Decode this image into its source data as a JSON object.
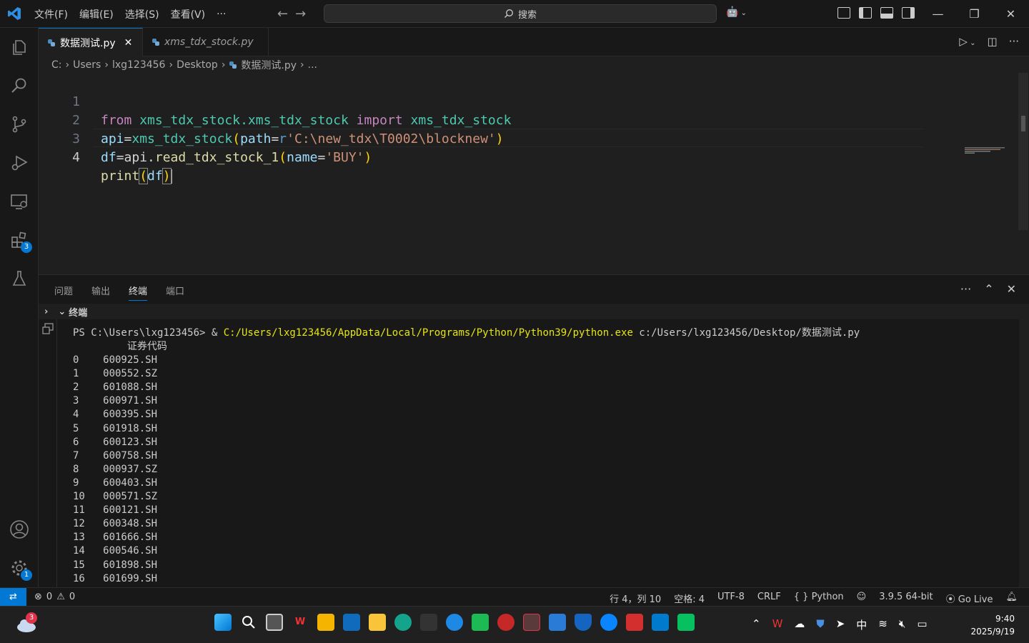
{
  "titlebar": {
    "menu": [
      "文件(F)",
      "编辑(E)",
      "选择(S)",
      "查看(V)",
      "···"
    ],
    "search_placeholder": "搜索"
  },
  "tabs": [
    {
      "label": "数据测试.py",
      "active": true
    },
    {
      "label": "xms_tdx_stock.py",
      "active": false
    }
  ],
  "breadcrumb": [
    "C:",
    "Users",
    "lxg123456",
    "Desktop",
    "数据测试.py",
    "..."
  ],
  "editor": {
    "line_numbers": [
      "1",
      "2",
      "3",
      "4"
    ],
    "lines": [
      {
        "kw": "from",
        "mod1": "xms_tdx_stock.xms_tdx_stock",
        "kw2": "import",
        "mod2": "xms_tdx_stock"
      },
      {
        "var": "api",
        "eq": "=",
        "fn": "xms_tdx_stock",
        "open": "(",
        "param": "path",
        "eq2": "=",
        "prefix": "r",
        "str": "'C:\\new_tdx\\T0002\\blocknew'",
        "close": ")"
      },
      {
        "var": "df",
        "eq": "=api.",
        "fn": "read_tdx_stock_1",
        "open": "(",
        "param": "name",
        "eq2": "=",
        "str": "'BUY'",
        "close": ")"
      },
      {
        "fn": "print",
        "open": "(",
        "var": "df",
        "close": ")"
      }
    ]
  },
  "panel": {
    "tabs": [
      "问题",
      "输出",
      "终端",
      "端口"
    ],
    "active_tab": "终端",
    "section_title": "终端"
  },
  "terminal": {
    "prompt": "PS C:\\Users\\lxg123456> & ",
    "exe": "C:/Users/lxg123456/AppData/Local/Programs/Python/Python39/python.exe",
    "script": " c:/Users/lxg123456/Desktop/数据测试.py",
    "header": "         证券代码",
    "rows": [
      "0    600925.SH",
      "1    000552.SZ",
      "2    601088.SH",
      "3    600971.SH",
      "4    600395.SH",
      "5    601918.SH",
      "6    600123.SH",
      "7    600758.SH",
      "8    000937.SZ",
      "9    600403.SH",
      "10   000571.SZ",
      "11   600121.SH",
      "12   600348.SH",
      "13   601666.SH",
      "14   600546.SH",
      "15   601898.SH",
      "16   601699.SH"
    ]
  },
  "statusbar": {
    "errors": "0",
    "warnings": "0",
    "position": "行 4，列 10",
    "spaces": "空格: 4",
    "encoding": "UTF-8",
    "eol": "CRLF",
    "language": "Python",
    "interpreter": "3.9.5 64-bit",
    "golive": "Go Live"
  },
  "activitybar": {
    "extensions_badge": "3",
    "settings_badge": "1"
  },
  "taskbar": {
    "weather_badge": "3",
    "ime": "中",
    "time": "9:40",
    "date": "2025/9/19"
  },
  "colors": {
    "accent": "#0078d4",
    "keyword": "#c586c0",
    "module": "#4ec9b0",
    "string": "#ce9178",
    "terminal_yellow": "#e5e510"
  }
}
